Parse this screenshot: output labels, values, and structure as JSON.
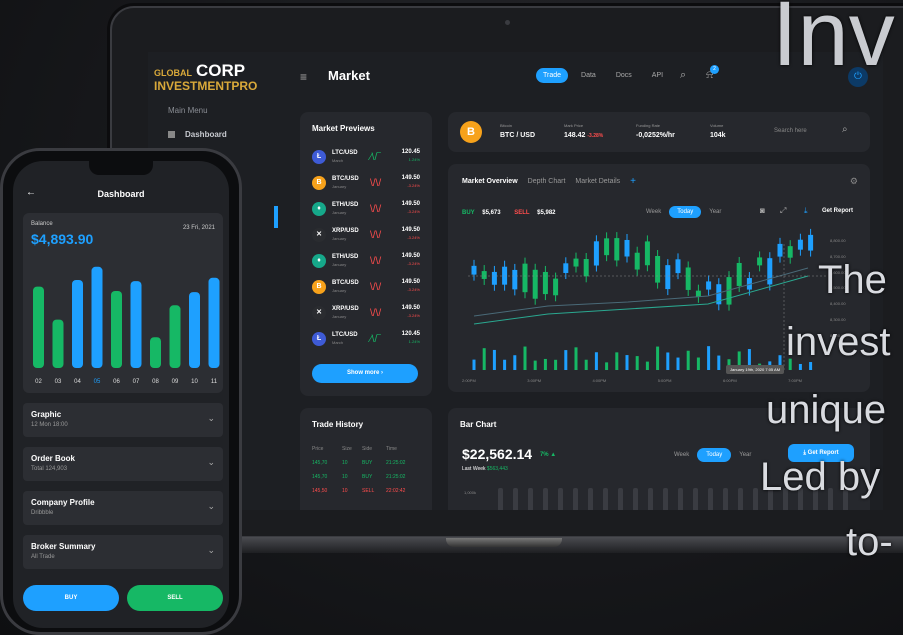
{
  "overlay": {
    "heading": "Inv",
    "lines": [
      "The",
      "invest",
      "unique",
      "Led by",
      "to-"
    ]
  },
  "brand": {
    "line1": "GLOBAL",
    "line2": "CORP",
    "line3": "INVESTMENTPRO"
  },
  "sidebar": {
    "section": "Main Menu",
    "item": "Dashboard"
  },
  "header": {
    "title": "Market",
    "tabs": [
      "Trade",
      "Data",
      "Docs",
      "API"
    ],
    "notif_count": "2"
  },
  "ticker": {
    "coin_name": "Bitcoin",
    "pair": "BTC / USD",
    "mark_price_label": "Mark Price",
    "mark_price": "148.42",
    "mark_change": "-3.28%",
    "funding_label": "Funding Rate",
    "funding": "-0,0252%/hr",
    "volume_label": "Volume",
    "volume": "104k",
    "search_placeholder": "Search here"
  },
  "market_previews": {
    "title": "Market Previews",
    "rows": [
      {
        "pair": "LTC/USD",
        "sub": "March",
        "value": "120.45",
        "change": "1.24%",
        "up": true,
        "coin": "Ł",
        "color": "#3e5bd6"
      },
      {
        "pair": "BTC/USD",
        "sub": "January",
        "value": "149.50",
        "change": "-3.24%",
        "up": false,
        "coin": "B",
        "color": "#f7a21b"
      },
      {
        "pair": "ETH/USD",
        "sub": "January",
        "value": "149.50",
        "change": "-3.24%",
        "up": false,
        "coin": "♦",
        "color": "#16a88a"
      },
      {
        "pair": "XRP/USD",
        "sub": "January",
        "value": "149.50",
        "change": "-3.24%",
        "up": false,
        "coin": "✕",
        "color": "#2a2c30"
      },
      {
        "pair": "ETH/USD",
        "sub": "January",
        "value": "149.50",
        "change": "-3.24%",
        "up": false,
        "coin": "♦",
        "color": "#16a88a"
      },
      {
        "pair": "BTC/USD",
        "sub": "January",
        "value": "149.50",
        "change": "-3.24%",
        "up": false,
        "coin": "B",
        "color": "#f7a21b"
      },
      {
        "pair": "XRP/USD",
        "sub": "January",
        "value": "149.50",
        "change": "-3.24%",
        "up": false,
        "coin": "✕",
        "color": "#2a2c30"
      },
      {
        "pair": "LTC/USD",
        "sub": "March",
        "value": "120.45",
        "change": "1.24%",
        "up": true,
        "coin": "Ł",
        "color": "#3e5bd6"
      }
    ],
    "show_more": "Show more ›"
  },
  "overview": {
    "tabs": [
      "Market Overview",
      "Depth Chart",
      "Market Details"
    ],
    "buy_label": "BUY",
    "buy": "$5,673",
    "sell_label": "SELL",
    "sell": "$5,982",
    "ranges": [
      "Week",
      "Today",
      "Year"
    ],
    "get_report": "Get Report",
    "tooltip": "January 19th, 2020 7:05 AM",
    "x_ticks": [
      "2:00PM",
      "3:00PM",
      "4:00PM",
      "5:00PM",
      "6:00PM",
      "7:00PM"
    ],
    "y_ticks": [
      "8,800.00",
      "8,700.00",
      "8,600.00",
      "8,500.00",
      "8,400.00",
      "8,300.00",
      "8,200.00"
    ]
  },
  "trade_history": {
    "title": "Trade History",
    "headers": [
      "Price",
      "Size",
      "Side",
      "Time"
    ],
    "rows": [
      {
        "price": "145,70",
        "size": "10",
        "side": "BUY",
        "time": "21:25:02"
      },
      {
        "price": "145,70",
        "size": "10",
        "side": "BUY",
        "time": "21:25:02"
      },
      {
        "price": "145,50",
        "size": "10",
        "side": "SELL",
        "time": "22:02:42"
      }
    ]
  },
  "bar_chart": {
    "title": "Bar Chart",
    "amount": "$22,562.14",
    "pct": "7% ▲",
    "period_label": "Last Week",
    "period_value": "$563,443",
    "ranges": [
      "Week",
      "Today",
      "Year"
    ],
    "get_report": "Get Report",
    "y_label": "1,000k"
  },
  "phone": {
    "title": "Dashboard",
    "balance_label": "Balance",
    "balance": "$4,893.90",
    "date": "23 Fri, 2021",
    "accordion": [
      {
        "title": "Graphic",
        "sub": "12 Mon 18:00"
      },
      {
        "title": "Order Book",
        "sub": "Total 124,903"
      },
      {
        "title": "Company Profile",
        "sub": "Dribbble"
      },
      {
        "title": "Broker Summary",
        "sub": "All Trade"
      }
    ],
    "buy": "BUY",
    "sell": "SELL"
  },
  "chart_data": {
    "type": "bar",
    "categories": [
      "02",
      "03",
      "04",
      "05",
      "06",
      "07",
      "08",
      "09",
      "10",
      "11"
    ],
    "series": [
      {
        "values": [
          0.74,
          0.44,
          0.8,
          0.92,
          0.7,
          0.79,
          0.28,
          0.57,
          0.69,
          0.82
        ]
      }
    ],
    "colors": [
      "#16b865",
      "#16b865",
      "#1ea0ff",
      "#1ea0ff",
      "#16b865",
      "#1ea0ff",
      "#16b865",
      "#16b865",
      "#1ea0ff",
      "#1ea0ff"
    ],
    "highlight": "05"
  }
}
